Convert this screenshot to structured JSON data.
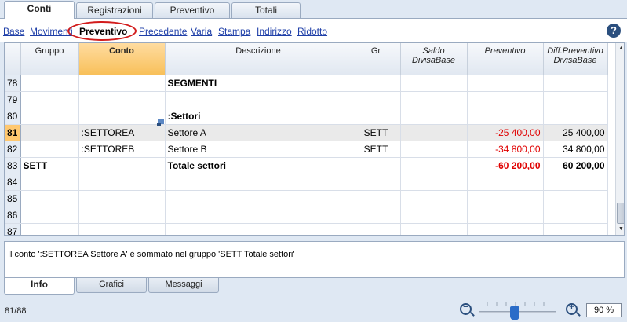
{
  "top_tabs": [
    {
      "label": "Conti",
      "active": true
    },
    {
      "label": "Registrazioni",
      "active": false
    },
    {
      "label": "Preventivo",
      "active": false
    },
    {
      "label": "Totali",
      "active": false
    }
  ],
  "views": [
    {
      "label": "Base",
      "active": false
    },
    {
      "label": "Movimenti",
      "active": false
    },
    {
      "label": "Preventivo",
      "active": true
    },
    {
      "label": "Precedente",
      "active": false
    },
    {
      "label": "Varia",
      "active": false
    },
    {
      "label": "Stampa",
      "active": false
    },
    {
      "label": "Indirizzo",
      "active": false
    },
    {
      "label": "Ridotto",
      "active": false
    }
  ],
  "help_icon": "?",
  "columns": [
    "Gruppo",
    "Conto",
    "Descrizione",
    "Gr",
    "Saldo DivisaBase",
    "Preventivo",
    "Diff.Preventivo DivisaBase"
  ],
  "rows": [
    {
      "n": "78",
      "gruppo": "",
      "conto": "",
      "descrizione": "SEGMENTI",
      "gr": "",
      "saldo": "",
      "preventivo": "",
      "diff": "",
      "bold": true,
      "current": false
    },
    {
      "n": "79",
      "gruppo": "",
      "conto": "",
      "descrizione": "",
      "gr": "",
      "saldo": "",
      "preventivo": "",
      "diff": "",
      "bold": false,
      "current": false
    },
    {
      "n": "80",
      "gruppo": "",
      "conto": "",
      "descrizione": ":Settori",
      "gr": "",
      "saldo": "",
      "preventivo": "",
      "diff": "",
      "bold": true,
      "current": false
    },
    {
      "n": "81",
      "gruppo": "",
      "conto": ":SETTOREA",
      "descrizione": "Settore A",
      "gr": "SETT",
      "saldo": "",
      "preventivo": "-25 400,00",
      "diff": "25 400,00",
      "bold": false,
      "current": true
    },
    {
      "n": "82",
      "gruppo": "",
      "conto": ":SETTOREB",
      "descrizione": "Settore B",
      "gr": "SETT",
      "saldo": "",
      "preventivo": "-34 800,00",
      "diff": "34 800,00",
      "bold": false,
      "current": false
    },
    {
      "n": "83",
      "gruppo": "SETT",
      "conto": "",
      "descrizione": "Totale settori",
      "gr": "",
      "saldo": "",
      "preventivo": "-60 200,00",
      "diff": "60 200,00",
      "bold": true,
      "current": false
    },
    {
      "n": "84",
      "gruppo": "",
      "conto": "",
      "descrizione": "",
      "gr": "",
      "saldo": "",
      "preventivo": "",
      "diff": "",
      "bold": false,
      "current": false
    },
    {
      "n": "85",
      "gruppo": "",
      "conto": "",
      "descrizione": "",
      "gr": "",
      "saldo": "",
      "preventivo": "",
      "diff": "",
      "bold": false,
      "current": false
    },
    {
      "n": "86",
      "gruppo": "",
      "conto": "",
      "descrizione": "",
      "gr": "",
      "saldo": "",
      "preventivo": "",
      "diff": "",
      "bold": false,
      "current": false
    },
    {
      "n": "87",
      "gruppo": "",
      "conto": "",
      "descrizione": "",
      "gr": "",
      "saldo": "",
      "preventivo": "",
      "diff": "",
      "bold": false,
      "current": false
    }
  ],
  "negative_color": "#e00000",
  "current_row_color": "#ffc870",
  "info_message": "Il conto ':SETTOREA Settore A' è sommato nel gruppo 'SETT Totale settori'",
  "bottom_tabs": [
    {
      "label": "Info",
      "active": true
    },
    {
      "label": "Grafici",
      "active": false
    },
    {
      "label": "Messaggi",
      "active": false
    }
  ],
  "status": {
    "position": "81/88",
    "zoom_level": "90 %"
  }
}
